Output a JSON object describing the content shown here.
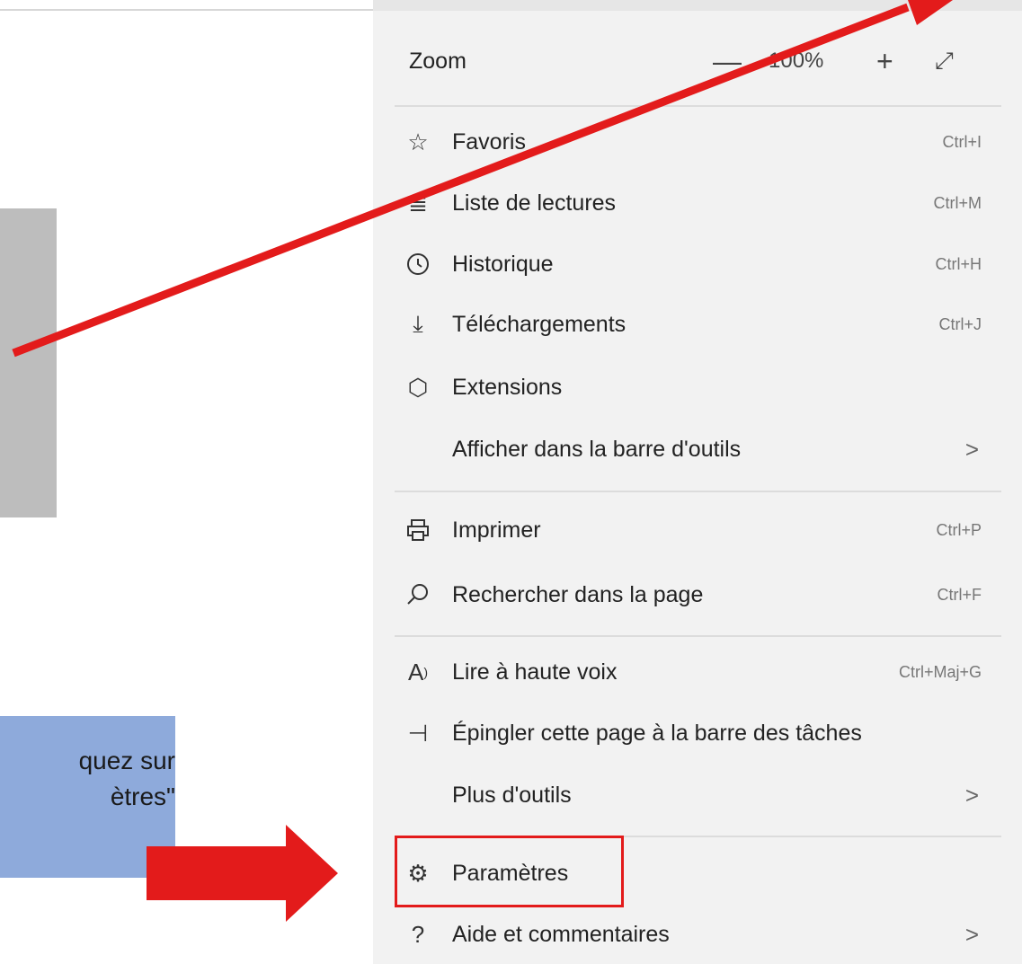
{
  "instruction": {
    "text_line1": "quez sur",
    "text_line2": "ètres\""
  },
  "menu": {
    "zoom": {
      "label": "Zoom",
      "minus": "—",
      "value": "100%",
      "plus": "+",
      "expand_icon": "expand-icon"
    },
    "items": [
      {
        "label": "Favoris",
        "shortcut": "Ctrl+I",
        "icon": "favorites-icon"
      },
      {
        "label": "Liste de lectures",
        "shortcut": "Ctrl+M",
        "icon": "reading-list-icon"
      },
      {
        "label": "Historique",
        "shortcut": "Ctrl+H",
        "icon": "history-icon"
      },
      {
        "label": "Téléchargements",
        "shortcut": "Ctrl+J",
        "icon": "download-icon"
      },
      {
        "label": "Extensions",
        "shortcut": "",
        "icon": "extensions-icon"
      },
      {
        "label": "Afficher dans la barre d'outils",
        "shortcut": "",
        "icon": ""
      },
      {
        "label": "Imprimer",
        "shortcut": "Ctrl+P",
        "icon": "print-icon"
      },
      {
        "label": "Rechercher dans la page",
        "shortcut": "Ctrl+F",
        "icon": "search-icon"
      },
      {
        "label": "Lire à haute voix",
        "shortcut": "Ctrl+Maj+G",
        "icon": "read-aloud-icon"
      },
      {
        "label": "Épingler cette page à la barre des tâches",
        "shortcut": "",
        "icon": "pin-icon"
      },
      {
        "label": "Plus d'outils",
        "shortcut": "",
        "icon": ""
      },
      {
        "label": "Paramètres",
        "shortcut": "",
        "icon": "gear-icon"
      },
      {
        "label": "Aide et commentaires",
        "shortcut": "",
        "icon": "help-icon"
      }
    ],
    "chevron": ">"
  },
  "colors": {
    "arrow": "#e31b1b",
    "menu_background": "#f2f2f2",
    "instruction_background": "#8eaadb"
  }
}
